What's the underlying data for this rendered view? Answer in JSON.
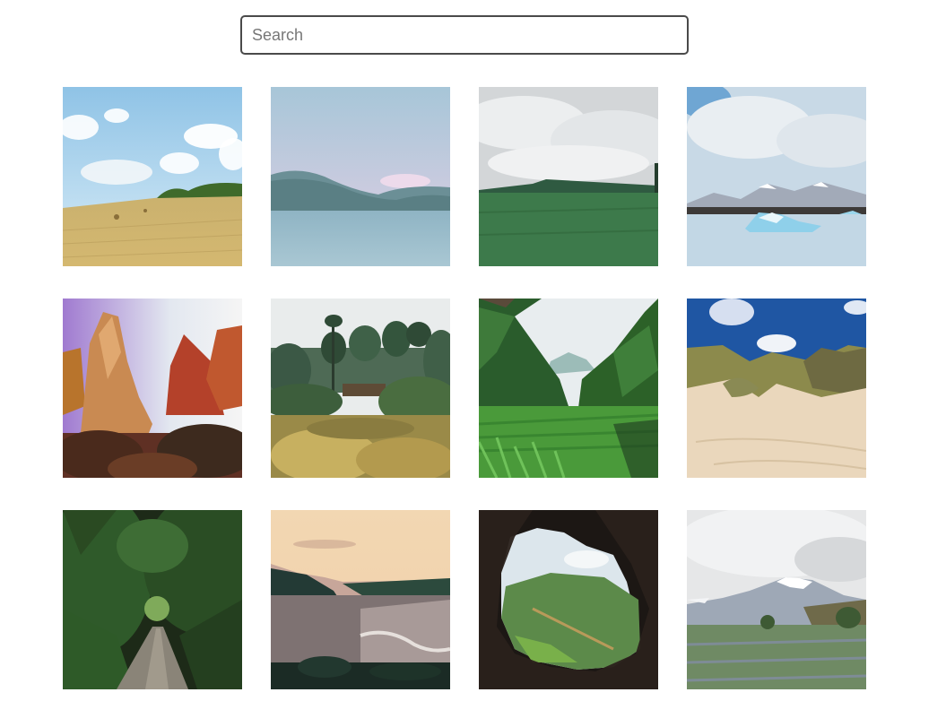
{
  "search": {
    "placeholder": "Search",
    "value": ""
  },
  "gallery": {
    "photos": [
      {
        "name": "photo-hay-field"
      },
      {
        "name": "photo-mountain-lake"
      },
      {
        "name": "photo-green-meadow-cloudy"
      },
      {
        "name": "photo-glacier-lagoon"
      },
      {
        "name": "photo-red-rock-canyon"
      },
      {
        "name": "photo-forest-garden"
      },
      {
        "name": "photo-jungle-valley"
      },
      {
        "name": "photo-sand-dunes"
      },
      {
        "name": "photo-forest-path"
      },
      {
        "name": "photo-coastal-sunset"
      },
      {
        "name": "photo-cave-view"
      },
      {
        "name": "photo-snowy-mountain-field"
      }
    ]
  }
}
